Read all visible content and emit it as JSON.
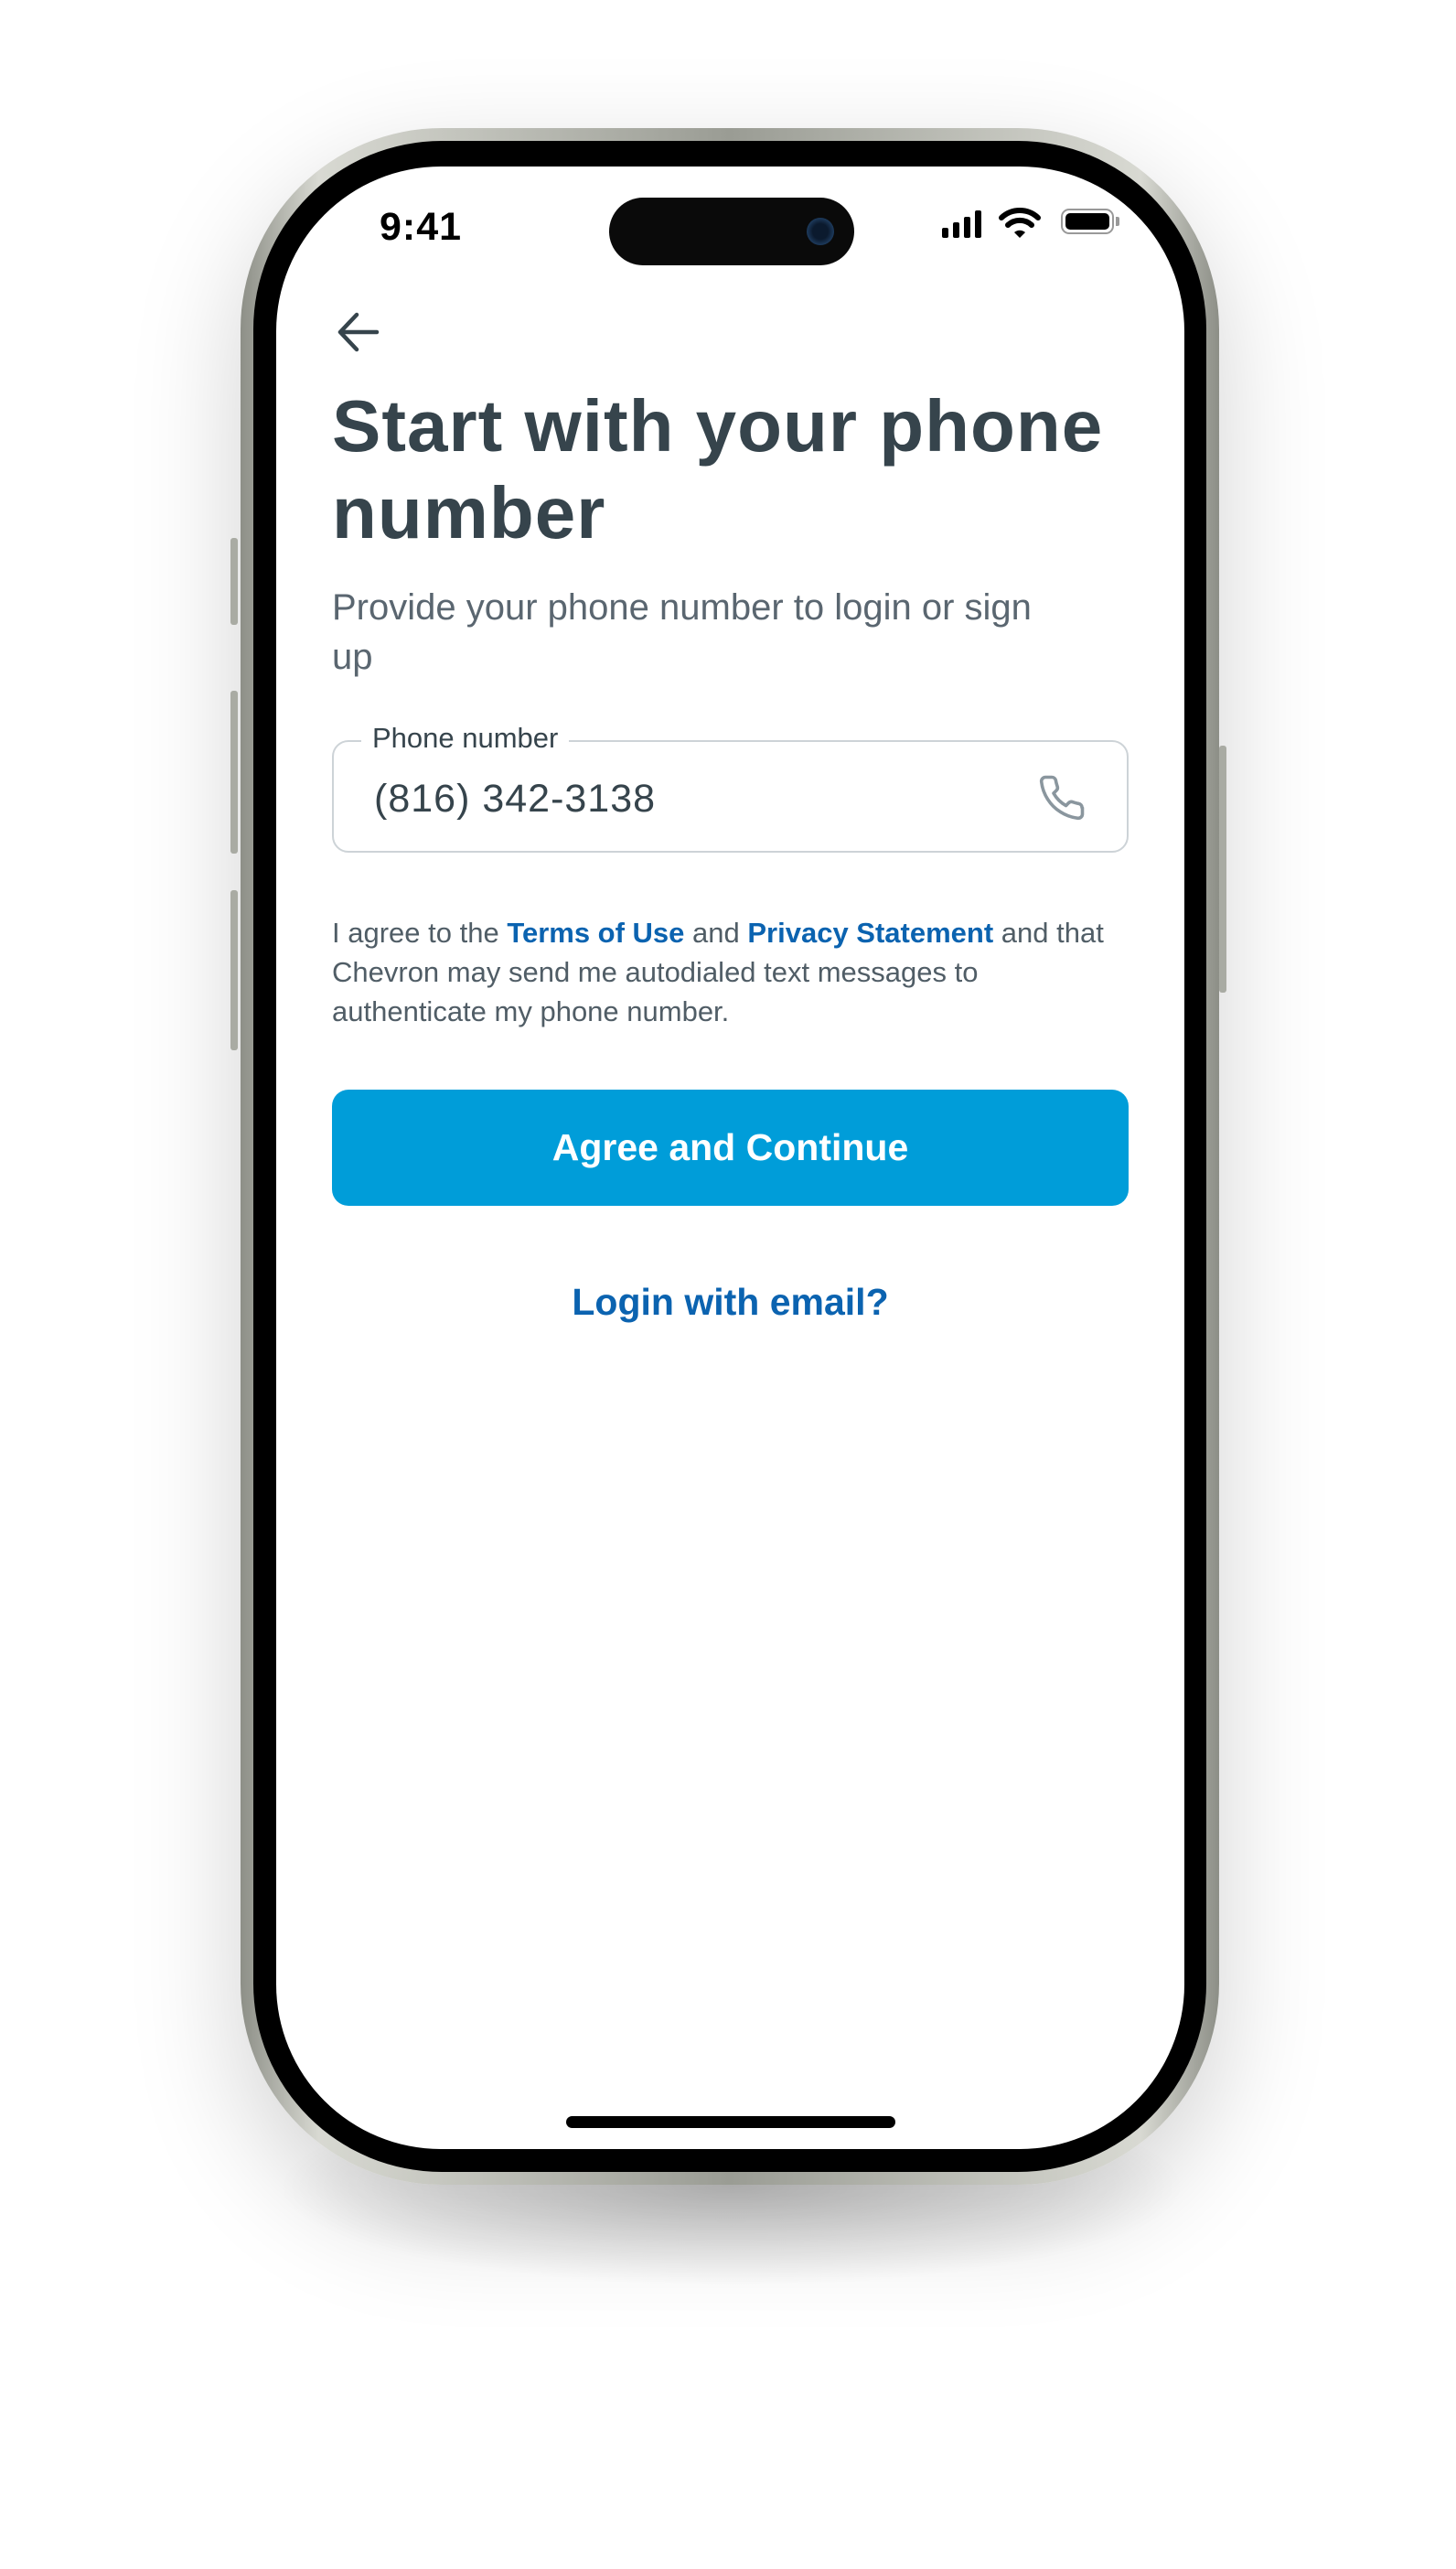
{
  "status_bar": {
    "time": "9:41",
    "icons": [
      "cellular-signal-icon",
      "wifi-icon",
      "battery-icon"
    ]
  },
  "header": {
    "back_icon": "arrow-left-icon",
    "title": "Start with your phone number",
    "subtitle": "Provide your phone number to login or sign up"
  },
  "phone_field": {
    "label": "Phone number",
    "value": "(816) 342-3138",
    "icon": "phone-icon"
  },
  "agreement": {
    "prefix": "I agree to the ",
    "terms_link": "Terms of Use",
    "middle": " and ",
    "privacy_link": "Privacy Statement",
    "suffix": " and that Chevron may send me autodialed text messages to authenticate my phone number."
  },
  "primary_button": {
    "label": "Agree and Continue"
  },
  "secondary_link": {
    "label": "Login with email?"
  },
  "colors": {
    "primary": "#009DD9",
    "link": "#0B63B0",
    "heading": "#36444C",
    "body": "#5A6670"
  }
}
